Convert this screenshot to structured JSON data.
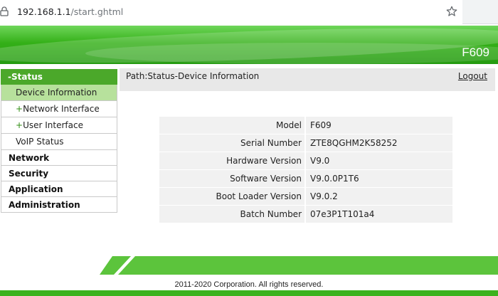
{
  "browser": {
    "url_host": "192.168.1.1",
    "url_path": "/start.ghtml"
  },
  "header": {
    "model": "F609",
    "accent_color": "#34b018"
  },
  "sidebar": {
    "status_heading": "-Status",
    "status_items": [
      {
        "prefix": "",
        "label": "Device Information"
      },
      {
        "prefix": "+",
        "label": "Network Interface"
      },
      {
        "prefix": "+",
        "label": "User Interface"
      },
      {
        "prefix": "",
        "label": "VoIP Status"
      }
    ],
    "main_items": [
      "Network",
      "Security",
      "Application",
      "Administration"
    ]
  },
  "content": {
    "path": "Path:Status-Device Information",
    "logout": "Logout",
    "rows": [
      {
        "label": "Model",
        "value": "F609"
      },
      {
        "label": "Serial Number",
        "value": "ZTE8QGHM2K58252"
      },
      {
        "label": "Hardware Version",
        "value": "V9.0"
      },
      {
        "label": "Software Version",
        "value": "V9.0.0P1T6"
      },
      {
        "label": "Boot Loader Version",
        "value": "V9.0.2"
      },
      {
        "label": "Batch Number",
        "value": "07e3P1T101a4"
      }
    ]
  },
  "footer": {
    "copyright": "2011-2020 Corporation. All rights reserved."
  }
}
